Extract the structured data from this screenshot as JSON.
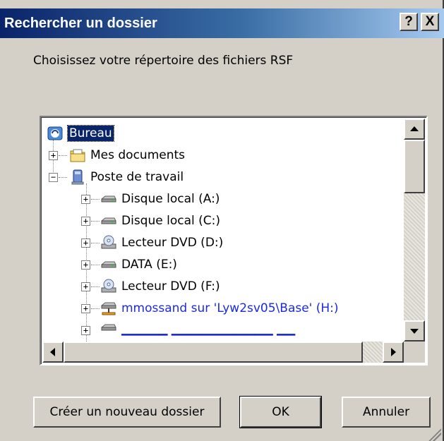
{
  "window": {
    "title": "Rechercher un dossier",
    "help_glyph": "?",
    "close_glyph": "X"
  },
  "prompt": "Choisissez votre répertoire des fichiers RSF",
  "tree": {
    "items": [
      {
        "label": "Bureau",
        "icon": "desktop-icon",
        "expander": "",
        "selected": true
      },
      {
        "label": "Mes documents",
        "icon": "folder-icon",
        "expander": "+"
      },
      {
        "label": "Poste de travail",
        "icon": "computer-icon",
        "expander": "−"
      },
      {
        "label": "Disque local (A:)",
        "icon": "drive-icon",
        "expander": "+"
      },
      {
        "label": "Disque local (C:)",
        "icon": "drive-icon",
        "expander": "+"
      },
      {
        "label": "Lecteur DVD (D:)",
        "icon": "dvd-drive-icon",
        "expander": "+"
      },
      {
        "label": "DATA (E:)",
        "icon": "drive-icon",
        "expander": "+"
      },
      {
        "label": "Lecteur DVD (F:)",
        "icon": "dvd-drive-icon",
        "expander": "+"
      },
      {
        "label": "mmossand sur 'Lyw2sv05\\Base' (H:)",
        "icon": "network-drive-icon",
        "expander": "+",
        "network": true
      }
    ]
  },
  "buttons": {
    "new_folder": "Créer un nouveau dossier",
    "ok": "OK",
    "cancel": "Annuler"
  },
  "colors": {
    "title_gradient_start": "#0a246a",
    "title_gradient_end": "#a6caf0",
    "dialog_bg": "#d4d0c8",
    "selection": "#0a246a",
    "network_link": "#1b2adf"
  }
}
